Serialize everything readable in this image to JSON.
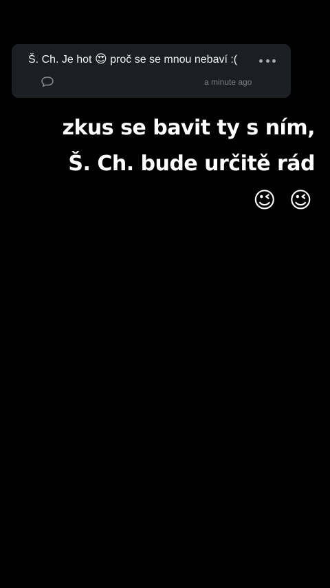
{
  "question": {
    "author_and_text": "Š. Ch. Je hot",
    "emoji": "😍",
    "text_after": " proč se se mnou nebaví :(",
    "timestamp": "a minute ago",
    "more_icon": "more-horizontal-icon",
    "comment_icon": "comment-icon"
  },
  "overlay": {
    "line1": "zkus se bavit ty s ním,",
    "line2": "Š. Ch. bude určitě rád",
    "emojis": "😉 😉"
  },
  "colors": {
    "background": "#000000",
    "card": "#1b1e23",
    "muted": "#7a7e86",
    "text": "#ffffff"
  }
}
